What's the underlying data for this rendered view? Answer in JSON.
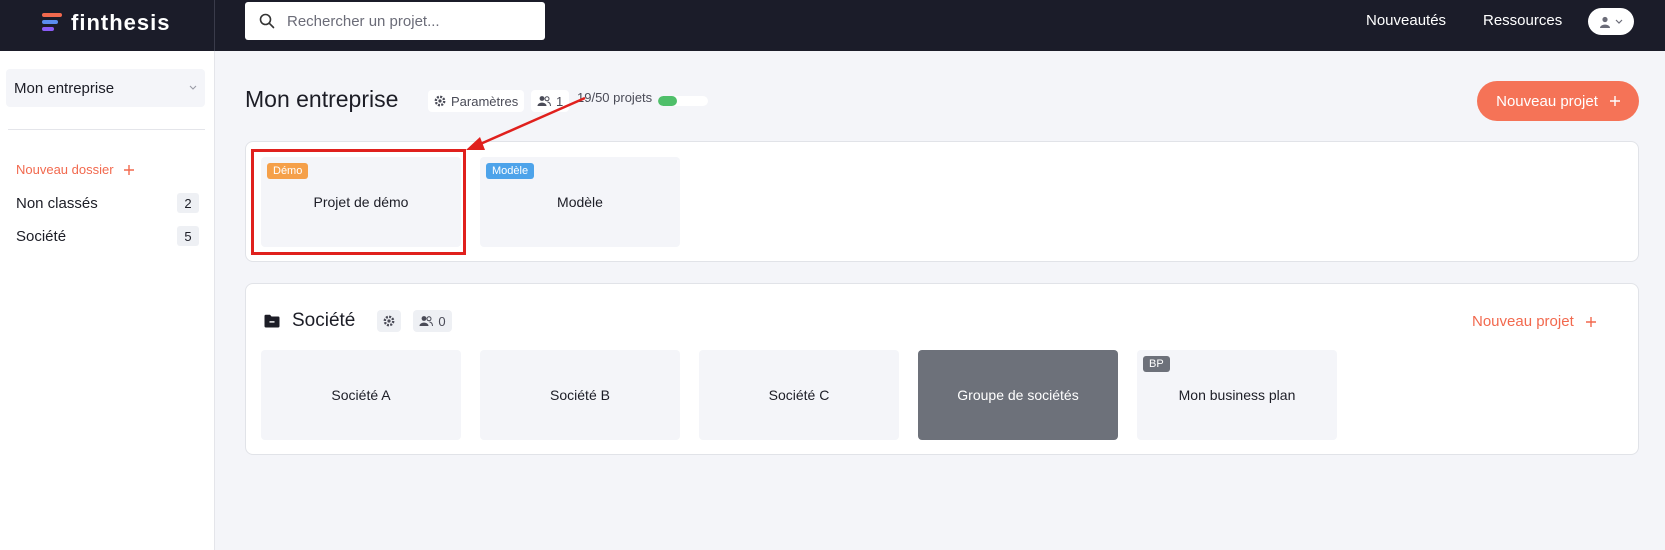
{
  "topbar": {
    "logo_text": "finthesis",
    "search_placeholder": "Rechercher un projet...",
    "nav_news": "Nouveautés",
    "nav_resources": "Ressources",
    "brand_colors": [
      "#f2694e",
      "#5b8def",
      "#8a5cf6"
    ]
  },
  "sidebar": {
    "company_select": "Mon entreprise",
    "new_folder": "Nouveau dossier",
    "folders": [
      {
        "label": "Non classés",
        "count": "2"
      },
      {
        "label": "Société",
        "count": "5"
      }
    ]
  },
  "main": {
    "title": "Mon entreprise",
    "settings_label": "Paramètres",
    "members_count": "1",
    "projects_usage": "19/50 projets",
    "projects_used": 19,
    "projects_max": 50,
    "new_project": "Nouveau projet",
    "top_cards": [
      {
        "tag": "Démo",
        "tag_color": "#f5a04a",
        "label": "Projet de démo"
      },
      {
        "tag": "Modèle",
        "tag_color": "#4da3ea",
        "label": "Modèle"
      }
    ],
    "folder_section": {
      "title": "Société",
      "members_count": "0",
      "new_project": "Nouveau projet",
      "cards": [
        {
          "label": "Société A"
        },
        {
          "label": "Société B"
        },
        {
          "label": "Société C"
        },
        {
          "label": "Groupe de sociétés"
        },
        {
          "tag": "BP",
          "tag_color": "#6d717a",
          "label": "Mon business plan"
        }
      ]
    }
  },
  "annotation": {
    "color": "#e0201d"
  }
}
